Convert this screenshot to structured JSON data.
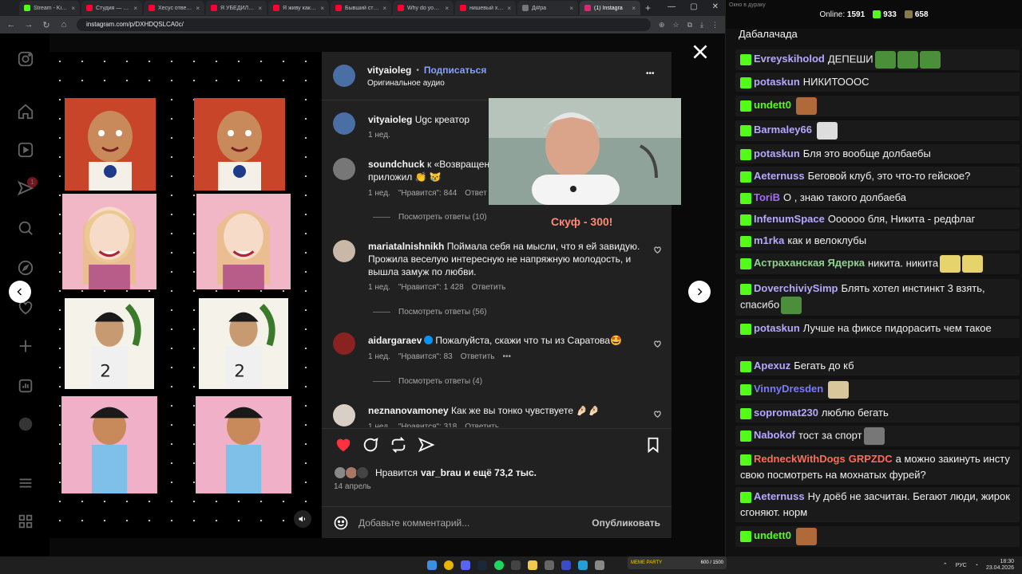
{
  "browser": {
    "tabs": [
      {
        "label": "Stream - Kick D",
        "color": "#53fc18"
      },
      {
        "label": "Студия — VK",
        "color": "#ff0033"
      },
      {
        "label": "Хесус ответил",
        "color": "#ff0033"
      },
      {
        "label": "Я УБЕДИЛ НЕ",
        "color": "#ff0033"
      },
      {
        "label": "Я живу как об",
        "color": "#ff0033"
      },
      {
        "label": "Бывший стрит",
        "color": "#ff0033"
      },
      {
        "label": "Why do young",
        "color": "#ff0033"
      },
      {
        "label": "нишевый хоуз",
        "color": "#ff0033"
      },
      {
        "label": "Ді#ра",
        "color": "#777777"
      },
      {
        "label": "(1) Instagra",
        "color": "#d62976",
        "active": true
      }
    ],
    "new_tab": "+",
    "url": "instagram.com/p/DXHDQSLCA0c/"
  },
  "post": {
    "author": "vityaioleg",
    "follow_label": "Подписаться",
    "dot": "•",
    "audio": "Оригинальное аудио",
    "more": "•••",
    "caption_author": "vityaioleg",
    "caption_text": "Ugc креатор",
    "caption_time": "1 нед.",
    "likes_prefix": "Нравится",
    "likes_user": "var_brau",
    "likes_suffix": "и ещё 73,2 тыс.",
    "date": "14 апрель",
    "comment_placeholder": "Добавьте комментарий...",
    "publish": "Опубликовать"
  },
  "comments": [
    {
      "user": "soundchuck",
      "text": "к «Возвращени",
      "text2": "приложил 👏 😿",
      "time": "1 нед.",
      "likes": "\"Нравится\": 844",
      "reply": "Ответ",
      "replies": "Посмотреть ответы (10)"
    },
    {
      "user": "mariatalnishnikh",
      "text": "Поймала себя на мысли, что я ей завидую. Прожила веселую интересную не напряжную молодость, и вышла замуж по любви.",
      "time": "1 нед.",
      "likes": "\"Нравится\": 1 428",
      "reply": "Ответить",
      "replies": "Посмотреть ответы (56)"
    },
    {
      "user": "aidargaraev",
      "text": "Пожалуйста, скажи что ты из Саратова🤩",
      "time": "1 нед.",
      "likes": "\"Нравится\": 83",
      "reply": "Ответить",
      "more": "•••",
      "replies": "Посмотреть ответы (4)"
    },
    {
      "user": "neznanovamoney",
      "text": "Как же вы тонко чувствуете 🤌🏻🤌🏻",
      "time": "1 нед.",
      "likes": "\"Нравится\": 318",
      "reply": "Ответить"
    }
  ],
  "facecam": {
    "caption": "Скуф - 300!"
  },
  "chat": {
    "window_title": "Окно в дураку",
    "online_label": "Online:",
    "online": "1591",
    "followers": "933",
    "subs": "658",
    "first_line": "Дабалачада",
    "messages": [
      {
        "user": "Evreyskiholod",
        "color": "#b6a8ff",
        "text": "ДЕПЕШИ",
        "emotes": [
          "#4b8f3a",
          "#4b8f3a",
          "#4b8f3a"
        ]
      },
      {
        "user": "potaskun",
        "color": "#b6a8ff",
        "text": "НИКИТОООС",
        "emotes": []
      },
      {
        "user": "undett0",
        "color": "#53fc18",
        "text": "",
        "emotes": [
          "#b06a3a"
        ]
      },
      {
        "user": "Barmaley66",
        "color": "#b6a8ff",
        "text": "",
        "emotes": [
          "#ddd"
        ]
      },
      {
        "user": "potaskun",
        "color": "#b6a8ff",
        "text": "Бля это вообще долбаебы",
        "emotes": []
      },
      {
        "user": "Aeternuss",
        "color": "#b6a8ff",
        "text": "Беговой клуб, это что-то гейское?",
        "emotes": []
      },
      {
        "user": "ToriB",
        "color": "#a56bff",
        "text": "О , знаю такого долбаеба",
        "emotes": []
      },
      {
        "user": "InfenumSpace",
        "color": "#b6a8ff",
        "text": "Оооооо бля, Никита - редфлаг",
        "emotes": []
      },
      {
        "user": "m1rka",
        "color": "#b6a8ff",
        "text": "как и велоклубы",
        "emotes": []
      },
      {
        "user": "Астраханская Ядерка",
        "color": "#8fd18f",
        "text": "никита. никита",
        "emotes": [
          "#e6d36b",
          "#e6d36b"
        ]
      },
      {
        "user": "DoverchiviySimp",
        "color": "#b6a8ff",
        "text": "Блять хотел инстинкт 3 взять, спасибо",
        "emotes": [
          "#4b8f3a"
        ]
      },
      {
        "user": "potaskun",
        "color": "#b6a8ff",
        "text": "Лучше на фиксе пидорасить чем такое",
        "emotes": []
      },
      {
        "user": "Apexuz",
        "color": "#b6a8ff",
        "text": "Бегать до кб",
        "emotes": []
      },
      {
        "user": "VinnyDresden",
        "color": "#7a7aff",
        "text": "",
        "emotes": [
          "#d8c79a"
        ]
      },
      {
        "user": "sopromat230",
        "color": "#b6a8ff",
        "text": "люблю бегать",
        "emotes": []
      },
      {
        "user": "Nabokof",
        "color": "#b6a8ff",
        "text": "тост за спорт",
        "emotes": [
          "#777"
        ]
      },
      {
        "user": "RedneckWithDogs",
        "color": "#ff6b5b",
        "extra": "GRPZDC",
        "text": "а можно закинуть инсту свою посмотреть на мохнатых фурей?",
        "emotes": []
      },
      {
        "user": "Aeternuss",
        "color": "#b6a8ff",
        "text": "Ну доёб не засчитан. Бегают люди, жирок сгоняют. норм",
        "emotes": []
      },
      {
        "user": "undett0",
        "color": "#53fc18",
        "text": "",
        "emotes": [
          "#b06a3a"
        ]
      }
    ]
  },
  "taskbar": {
    "lang": "РУС",
    "time": "18:30",
    "date": "23.04.2026",
    "meme_label": "MEME PARTY",
    "meme_progress": "600 / 1500"
  },
  "colors": {
    "follow": "#85a1ff",
    "like": "#ff3040",
    "kick": "#53fc18"
  }
}
